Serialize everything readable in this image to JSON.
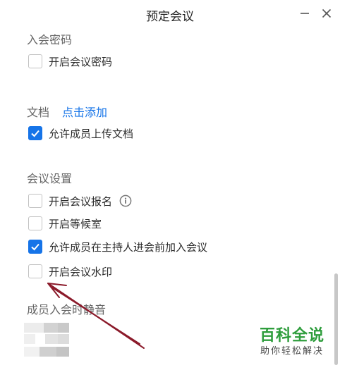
{
  "window": {
    "title": "预定会议",
    "minimize_icon": "minimize-icon",
    "close_icon": "close-icon"
  },
  "sections": {
    "password": {
      "title": "入会密码",
      "items": [
        {
          "label": "开启会议密码",
          "checked": false
        }
      ]
    },
    "documents": {
      "title": "文档",
      "link": "点击添加",
      "items": [
        {
          "label": "允许成员上传文档",
          "checked": true
        }
      ]
    },
    "settings": {
      "title": "会议设置",
      "items": [
        {
          "label": "开启会议报名",
          "checked": false,
          "info_icon": "info-icon"
        },
        {
          "label": "开启等候室",
          "checked": false
        },
        {
          "label": "允许成员在主持人进会前加入会议",
          "checked": true
        },
        {
          "label": "开启会议水印",
          "checked": false
        }
      ]
    },
    "mute": {
      "title": "成员入会时静音"
    }
  },
  "watermark": {
    "main": "百科全说",
    "sub": "助你轻松解决"
  },
  "colors": {
    "accent": "#1674e8",
    "annotation_arrow": "#8b1a2a",
    "watermark_green": "#2e9d3c"
  }
}
